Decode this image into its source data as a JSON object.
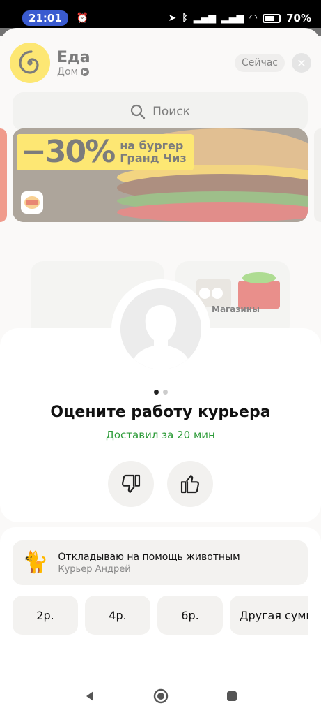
{
  "status_bar": {
    "time": "21:01",
    "battery": "70%"
  },
  "header": {
    "title": "Еда",
    "address": "Дом",
    "now_label": "Сейчас"
  },
  "search": {
    "label": "Поиск"
  },
  "banner": {
    "discount": "−30%",
    "line1": "на бургер",
    "line2": "Гранд Чиз",
    "brand_logo_text": "BURGER KING"
  },
  "categories": {
    "shops_label": "Магазины"
  },
  "rating": {
    "pager": {
      "count": 2,
      "active": 0
    },
    "title": "Оцените работу курьера",
    "subtitle": "Доставил за 20 мин"
  },
  "donation": {
    "title": "Откладываю на помощь животным",
    "courier": "Курьер Андрей"
  },
  "tips": [
    "2р.",
    "4р.",
    "6р.",
    "Другая сумма"
  ],
  "colors": {
    "brand_yellow": "#fbd400",
    "success_green": "#2e9c3a"
  }
}
